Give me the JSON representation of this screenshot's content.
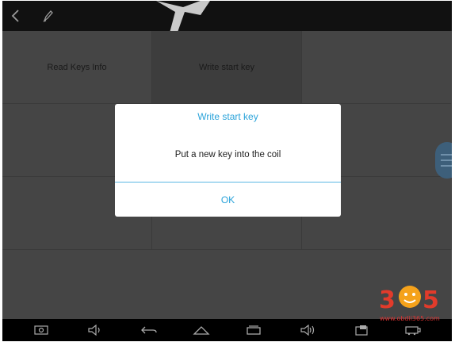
{
  "menu": {
    "cells": [
      {
        "label": "Read Keys Info"
      },
      {
        "label": "Write start key"
      },
      {
        "label": ""
      }
    ]
  },
  "dialog": {
    "title": "Write start key",
    "message": "Put a new key into the coil",
    "ok_label": "OK"
  },
  "watermark": {
    "logo_text": "365",
    "url": "www.obdii365.com"
  },
  "icons": {
    "top": [
      "back-icon",
      "edit-icon"
    ],
    "nav": [
      "screenshot-icon",
      "volume-down-icon",
      "back-icon",
      "home-icon",
      "recent-apps-icon",
      "volume-up-icon",
      "app-icon",
      "vci-icon"
    ]
  },
  "colors": {
    "accent": "#2aa3da",
    "watermark_red": "#d33"
  }
}
